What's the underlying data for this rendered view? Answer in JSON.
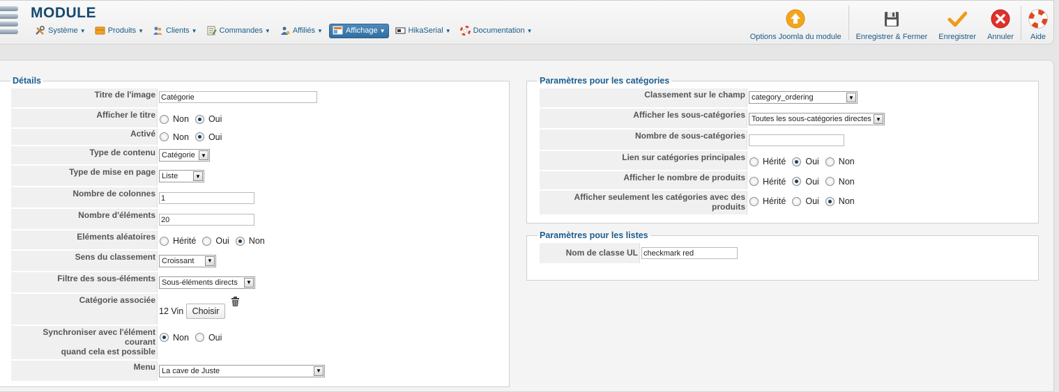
{
  "header": {
    "title": "MODULE",
    "menu": [
      {
        "label": "Système",
        "icon": "tools-icon"
      },
      {
        "label": "Produits",
        "icon": "products-icon"
      },
      {
        "label": "Clients",
        "icon": "clients-icon"
      },
      {
        "label": "Commandes",
        "icon": "orders-icon"
      },
      {
        "label": "Affiliés",
        "icon": "affiliates-icon"
      },
      {
        "label": "Affichage",
        "icon": "display-icon",
        "active": true
      },
      {
        "label": "HikaSerial",
        "icon": "hikaserial-icon"
      },
      {
        "label": "Documentation",
        "icon": "documentation-icon"
      }
    ],
    "toolbar": {
      "options": "Options Joomla du module",
      "save_close": "Enregistrer & Fermer",
      "save": "Enregistrer",
      "cancel": "Annuler",
      "help": "Aide"
    }
  },
  "details": {
    "legend": "Détails",
    "image_title_label": "Titre de l'image",
    "image_title_value": "Catégorie",
    "show_title_label": "Afficher le titre",
    "active_label": "Activé",
    "no": "Non",
    "yes": "Oui",
    "inherited": "Hérité",
    "content_type_label": "Type de contenu",
    "content_type_value": "Catégorie",
    "layout_type_label": "Type de mise en page",
    "layout_type_value": "Liste",
    "columns_label": "Nombre de colonnes",
    "columns_value": "1",
    "elements_label": "Nombre d'éléments",
    "elements_value": "20",
    "random_label": "Eléments aléatoires",
    "order_dir_label": "Sens du classement",
    "order_dir_value": "Croissant",
    "sub_filter_label": "Filtre des sous-éléments",
    "sub_filter_value": "Sous-éléments directs",
    "assoc_cat_label": "Catégorie associée",
    "assoc_cat_value": "12 Vin",
    "choose_button": "Choisir",
    "sync_label_1": "Synchroniser avec l'élément courant",
    "sync_label_2": "quand cela est possible",
    "menu_label": "Menu",
    "menu_value": "La cave de Juste"
  },
  "categories": {
    "legend": "Paramètres pour les catégories",
    "order_field_label": "Classement sur le champ",
    "order_field_value": "category_ordering",
    "show_sub_label": "Afficher les sous-catégories",
    "show_sub_value": "Toutes les sous-catégories directes",
    "sub_count_label": "Nombre de sous-catégories",
    "sub_count_value": "",
    "main_link_label": "Lien sur catégories principales",
    "product_count_label": "Afficher le nombre de produits",
    "only_with_products_label": "Afficher seulement les catégories avec des produits",
    "inherited": "Hérité",
    "yes": "Oui",
    "no": "Non"
  },
  "lists": {
    "legend": "Paramètres pour les listes",
    "ul_class_label": "Nom de classe UL",
    "ul_class_value": "checkmark red"
  }
}
